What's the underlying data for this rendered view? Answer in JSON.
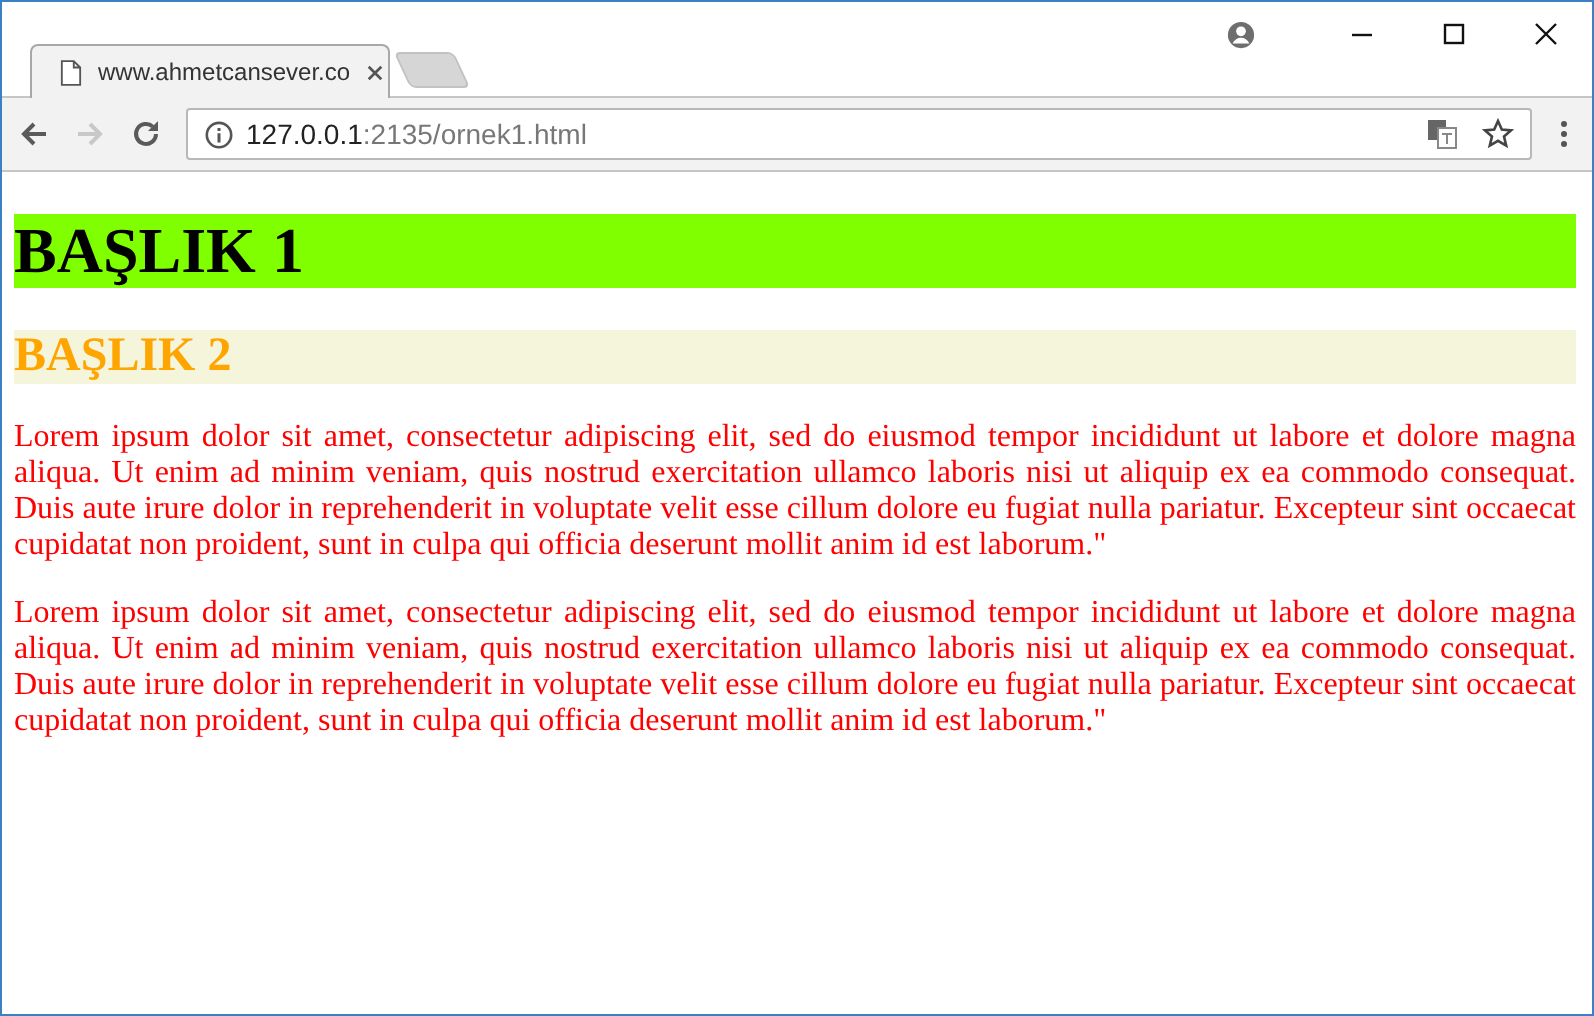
{
  "browser": {
    "tabs": [
      {
        "title": "www.ahmetcansever.co",
        "selected": true,
        "kind": "page"
      },
      {
        "kind": "new"
      }
    ],
    "address": {
      "host": "127.0.0.1",
      "path": ":2135/ornek1.html"
    }
  },
  "page": {
    "heading_1": "BAŞLIK 1",
    "heading_2": "BAŞLIK 2",
    "paragraphs": [
      "Lorem ipsum dolor sit amet, consectetur adipiscing elit, sed do eiusmod tempor incididunt ut labore et dolore magna aliqua. Ut enim ad minim veniam, quis nostrud exercitation ullamco laboris nisi ut aliquip ex ea commodo consequat. Duis aute irure dolor in reprehenderit in voluptate velit esse cillum dolore eu fugiat nulla pariatur. Excepteur sint occaecat cupidatat non proident, sunt in culpa qui officia deserunt mollit anim id est laborum.\"",
      "Lorem ipsum dolor sit amet, consectetur adipiscing elit, sed do eiusmod tempor incididunt ut labore et dolore magna aliqua. Ut enim ad minim veniam, quis nostrud exercitation ullamco laboris nisi ut aliquip ex ea commodo consequat. Duis aute irure dolor in reprehenderit in voluptate velit esse cillum dolore eu fugiat nulla pariatur. Excepteur sint occaecat cupidatat non proident, sunt in culpa qui officia deserunt mollit anim id est laborum.\""
    ]
  }
}
